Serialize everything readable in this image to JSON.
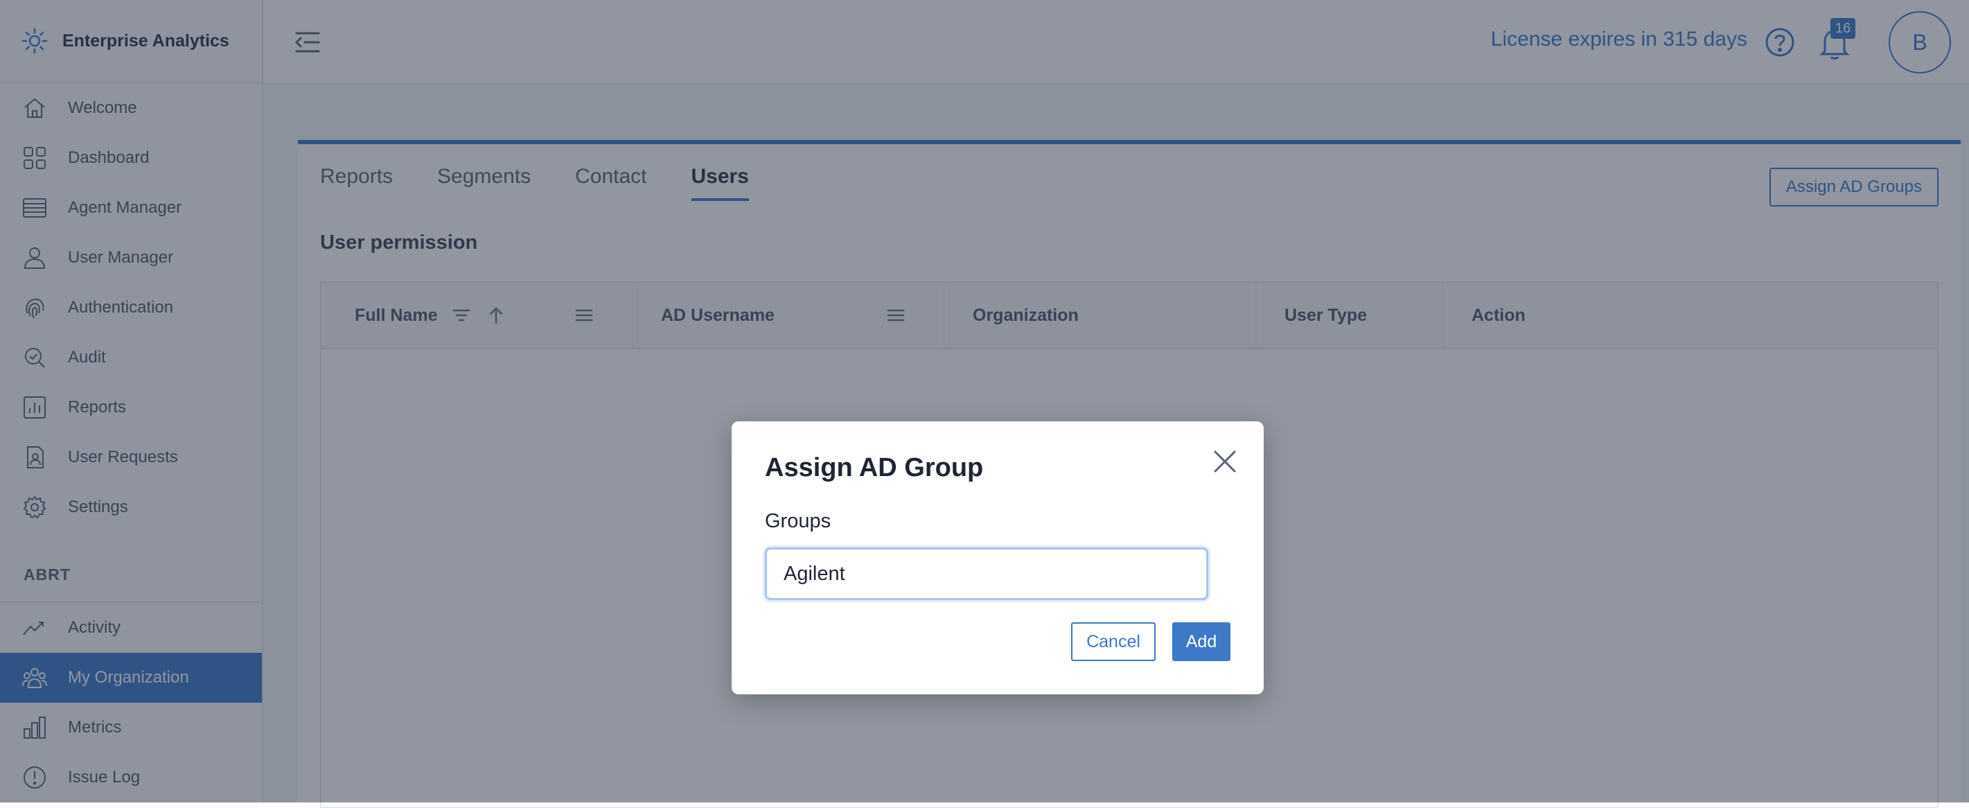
{
  "app": {
    "title": "Enterprise Analytics"
  },
  "sidebar": {
    "items": [
      {
        "label": "Welcome",
        "icon": "home-icon"
      },
      {
        "label": "Dashboard",
        "icon": "dashboard-icon"
      },
      {
        "label": "Agent Manager",
        "icon": "agent-manager-icon"
      },
      {
        "label": "User Manager",
        "icon": "user-icon"
      },
      {
        "label": "Authentication",
        "icon": "fingerprint-icon"
      },
      {
        "label": "Audit",
        "icon": "audit-icon"
      },
      {
        "label": "Reports",
        "icon": "reports-icon"
      },
      {
        "label": "User Requests",
        "icon": "user-requests-icon"
      },
      {
        "label": "Settings",
        "icon": "gear-icon"
      }
    ],
    "section_label": "ABRT",
    "section_items": [
      {
        "label": "Activity",
        "icon": "activity-icon"
      },
      {
        "label": "My Organization",
        "icon": "organization-icon",
        "active": true
      },
      {
        "label": "Metrics",
        "icon": "metrics-icon"
      },
      {
        "label": "Issue Log",
        "icon": "issue-log-icon"
      }
    ]
  },
  "header": {
    "license_text": "License expires in 315 days",
    "notification_count": "16",
    "avatar_initial": "B"
  },
  "main": {
    "tabs": [
      {
        "label": "Reports"
      },
      {
        "label": "Segments"
      },
      {
        "label": "Contact"
      },
      {
        "label": "Users",
        "active": true
      }
    ],
    "assign_button_label": "Assign AD Groups",
    "subtitle": "User permission",
    "table": {
      "columns": [
        "Full Name",
        "AD Username",
        "Organization",
        "User Type",
        "Action"
      ]
    }
  },
  "modal": {
    "title": "Assign AD Group",
    "field_label": "Groups",
    "input_value": "Agilent",
    "cancel_label": "Cancel",
    "add_label": "Add"
  },
  "colors": {
    "accent": "#3d78c9",
    "overlay": "#242e42"
  }
}
